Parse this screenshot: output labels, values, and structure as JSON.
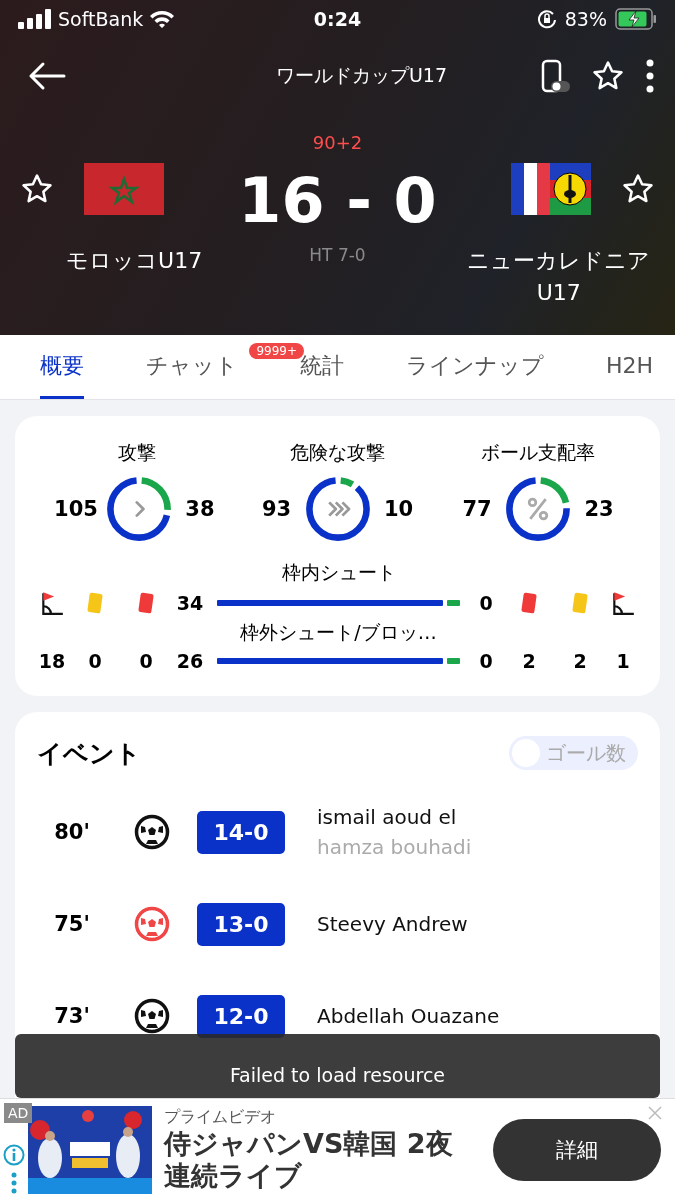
{
  "status_bar": {
    "carrier": "SoftBank",
    "time": "0:24",
    "battery": "83%"
  },
  "header": {
    "title": "ワールドカップU17"
  },
  "match": {
    "minute": "90+2",
    "score": "16 - 0",
    "halftime": "HT 7-0",
    "home": {
      "name": "モロッコU17",
      "kind": "morocco"
    },
    "away": {
      "name": "ニューカレドニア U17",
      "kind": "new_caledonia"
    }
  },
  "tabs": [
    {
      "label": "概要",
      "selected": true
    },
    {
      "label": "チャット",
      "selected": false,
      "badge": "9999+"
    },
    {
      "label": "統計",
      "selected": false
    },
    {
      "label": "ラインナップ",
      "selected": false
    },
    {
      "label": "H2H",
      "selected": false
    }
  ],
  "donuts": [
    {
      "label": "攻撃",
      "kind": "attack",
      "home": "105",
      "away": "38",
      "level": 0.73
    },
    {
      "label": "危険な攻撃",
      "kind": "dangerous",
      "home": "93",
      "away": "10",
      "level": 0.9
    },
    {
      "label": "ボール支配率",
      "kind": "possession",
      "home": "77",
      "away": "23",
      "level": 0.77
    }
  ],
  "side_stats": {
    "home": [
      {
        "kind": "corner",
        "value": "18"
      },
      {
        "kind": "yellow_card",
        "value": "0"
      },
      {
        "kind": "red_card",
        "value": "0"
      }
    ],
    "away": [
      {
        "kind": "red_card",
        "value": "2"
      },
      {
        "kind": "yellow_card",
        "value": "2"
      },
      {
        "kind": "corner",
        "value": "1"
      }
    ]
  },
  "bars": [
    {
      "label": "枠内シュート",
      "home": "34",
      "away": "0",
      "level": 0.93
    },
    {
      "label": "枠外シュート/ブロッ…",
      "home": "26",
      "away": "0",
      "level": 0.93
    }
  ],
  "events": {
    "title": "イベント",
    "toggle": {
      "label": "ゴール数",
      "on": false
    },
    "items": [
      {
        "minute": "80'",
        "kind": "goal",
        "score": "14-0",
        "player": "ismail aoud el",
        "assist": "hamza bouhadi"
      },
      {
        "minute": "75'",
        "kind": "penalty_goal",
        "score": "13-0",
        "player": "Steevy Andrew"
      },
      {
        "minute": "73'",
        "kind": "goal",
        "score": "12-0",
        "player": "Abdellah Ouazane"
      }
    ]
  },
  "toast": "Failed to load resource",
  "ad": {
    "badge": "AD",
    "advertiser": "プライムビデオ",
    "headline": "侍ジャパンVS韓国 2夜連続ライブ",
    "button": "詳細"
  }
}
